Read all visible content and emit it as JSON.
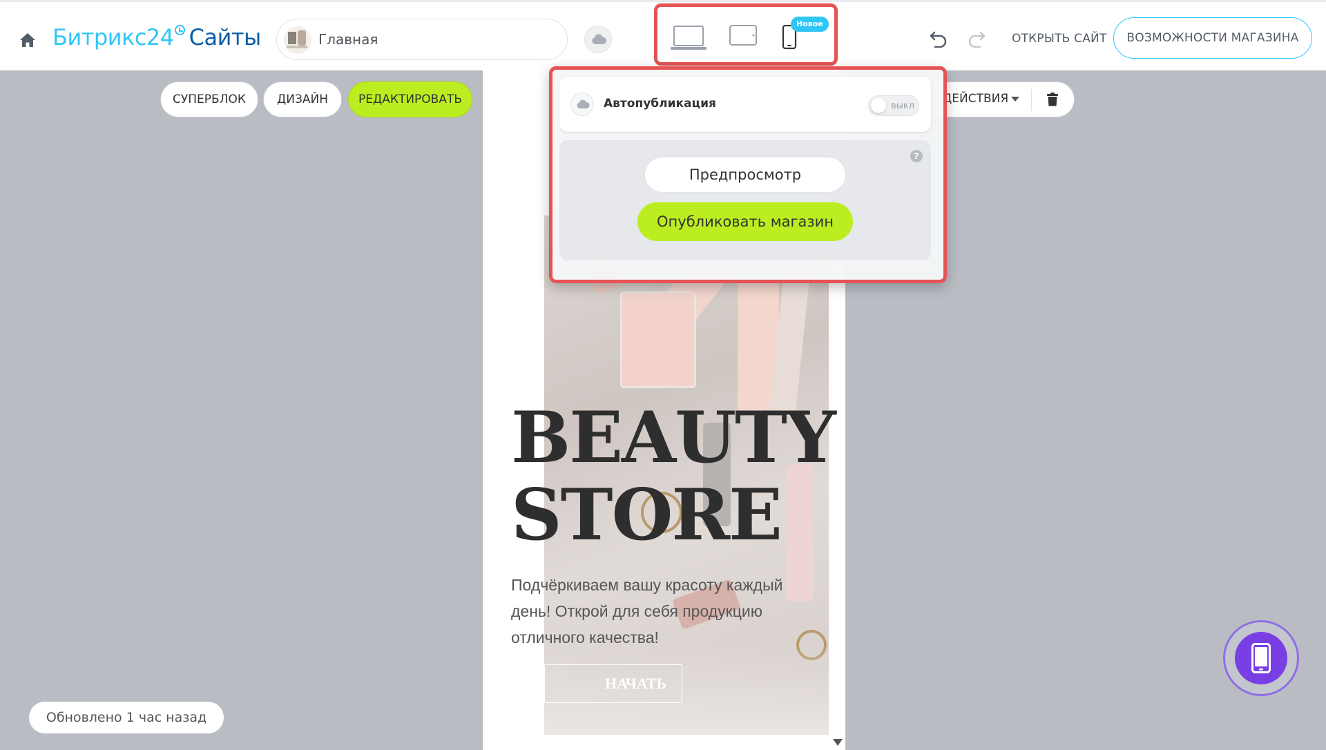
{
  "header": {
    "logo_brand": "Битрикс24",
    "logo_product": "Сайты",
    "page_selector": {
      "label": "Главная"
    },
    "device_switcher": {
      "devices": [
        "desktop",
        "tablet",
        "mobile"
      ],
      "active": "mobile",
      "new_badge": "Новое"
    },
    "open_site_label": "ОТКРЫТЬ САЙТ",
    "shop_features_label": "ВОЗМОЖНОСТИ МАГАЗИНА"
  },
  "toolbar": {
    "superblock_label": "СУПЕРБЛОК",
    "design_label": "ДИЗАЙН",
    "edit_label": "РЕДАКТИРОВАТЬ",
    "actions_label": "ДЕЙСТВИЯ"
  },
  "publish_popup": {
    "autopublish_label": "Автопубликация",
    "autopublish_state": "выкл",
    "help": "?",
    "preview_label": "Предпросмотр",
    "publish_label": "Опубликовать магазин"
  },
  "preview": {
    "hero_title": "BEAUTY\nSTORE",
    "hero_description": "Подчёркиваем вашу красоту каждый день! Открой для себя продукцию отличного качества!",
    "cta_label": "НАЧАТЬ ПОКУПКИ"
  },
  "footer": {
    "updated_label": "Обновлено 1 час назад"
  },
  "colors": {
    "accent_blue": "#2fc6f6",
    "accent_green": "#bbed21",
    "highlight_red": "#e65355",
    "fab_purple": "#7a3fe4",
    "canvas_gray": "#b9bdc3"
  },
  "icons": {
    "home": "home-icon",
    "cloud": "cloud-icon",
    "undo": "undo-icon",
    "redo": "redo-icon",
    "trash": "trash-icon",
    "help": "help-icon",
    "mobile_fab": "mobile-phone-icon"
  }
}
